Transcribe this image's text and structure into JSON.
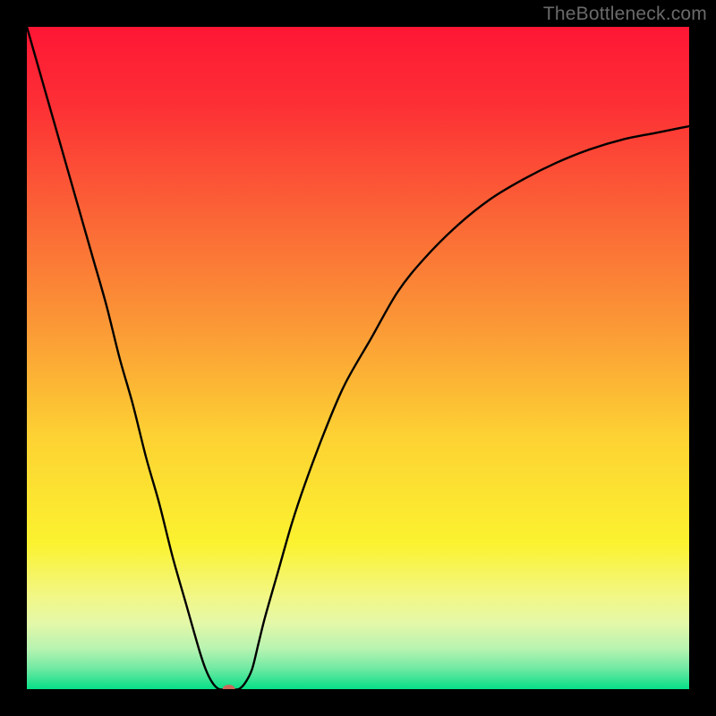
{
  "watermark": "TheBottleneck.com",
  "chart_data": {
    "type": "line",
    "title": "",
    "xlabel": "",
    "ylabel": "",
    "xlim": [
      0,
      100
    ],
    "ylim": [
      0,
      100
    ],
    "grid": false,
    "legend": false,
    "annotations": [],
    "background": {
      "type": "vertical_gradient",
      "stops": [
        {
          "pos": 0.0,
          "color": "#fe1635"
        },
        {
          "pos": 0.12,
          "color": "#fd3035"
        },
        {
          "pos": 0.28,
          "color": "#fb6336"
        },
        {
          "pos": 0.45,
          "color": "#fb9836"
        },
        {
          "pos": 0.62,
          "color": "#fdd233"
        },
        {
          "pos": 0.78,
          "color": "#fbf22f"
        },
        {
          "pos": 0.86,
          "color": "#f2f786"
        },
        {
          "pos": 0.9,
          "color": "#e4f8a8"
        },
        {
          "pos": 0.94,
          "color": "#b6f3b1"
        },
        {
          "pos": 0.97,
          "color": "#6de9a2"
        },
        {
          "pos": 1.0,
          "color": "#06df87"
        }
      ]
    },
    "series": [
      {
        "name": "bottleneck-curve",
        "color": "#000000",
        "x": [
          0,
          2,
          4,
          6,
          8,
          10,
          12,
          14,
          16,
          18,
          20,
          22,
          24,
          26,
          27,
          28,
          29,
          30,
          31,
          32,
          33,
          34,
          35,
          36,
          38,
          40,
          42,
          45,
          48,
          52,
          56,
          60,
          65,
          70,
          75,
          80,
          85,
          90,
          95,
          100
        ],
        "y": [
          100,
          93,
          86,
          79,
          72,
          65,
          58,
          50,
          43,
          35,
          28,
          20,
          13,
          6,
          3,
          1,
          0,
          0,
          0,
          0,
          1,
          3,
          7,
          11,
          18,
          25,
          31,
          39,
          46,
          53,
          60,
          65,
          70,
          74,
          77,
          79.5,
          81.5,
          83,
          84,
          85
        ]
      }
    ],
    "marker": {
      "name": "optimal-point",
      "x": 30.5,
      "y": 0,
      "color": "#c96a5b",
      "rx": 7,
      "ry": 5
    }
  }
}
